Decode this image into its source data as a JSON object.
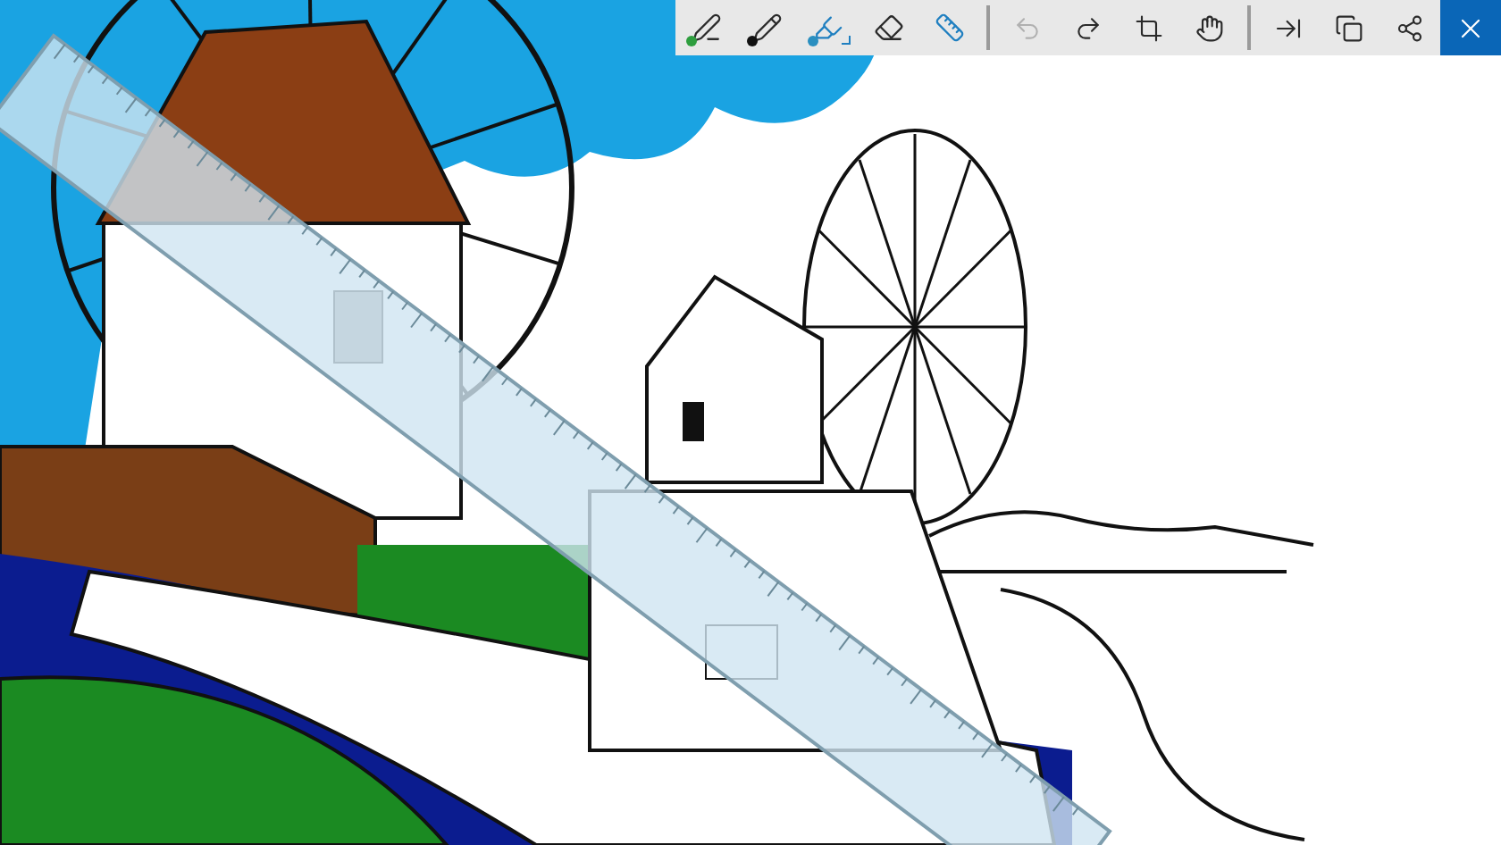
{
  "toolbar": {
    "tools": [
      {
        "kind": "ballpoint",
        "color": "#2e9e3e",
        "selected": false
      },
      {
        "kind": "pencil",
        "color": "#111111",
        "selected": false
      },
      {
        "kind": "highlighter",
        "color": "#2a8fc0",
        "selected": true
      },
      {
        "kind": "eraser",
        "selected": false
      },
      {
        "kind": "ruler",
        "selected": true
      }
    ],
    "actions": [
      {
        "kind": "undo",
        "disabled": true
      },
      {
        "kind": "redo",
        "disabled": false
      },
      {
        "kind": "crop",
        "disabled": false
      },
      {
        "kind": "touch",
        "disabled": false
      }
    ],
    "share": [
      {
        "kind": "export"
      },
      {
        "kind": "copy"
      },
      {
        "kind": "share"
      }
    ]
  }
}
